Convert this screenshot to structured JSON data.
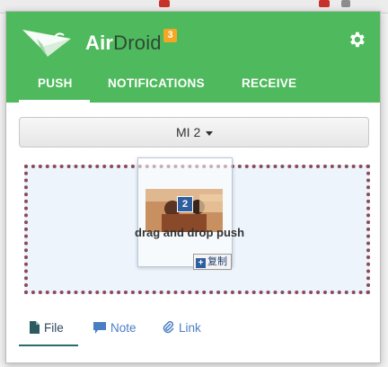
{
  "app": {
    "name_part1": "Air",
    "name_part2": "Droid",
    "badge_count": "3",
    "brand_color": "#4fba5d"
  },
  "header": {
    "tabs": [
      {
        "label": "PUSH",
        "active": true
      },
      {
        "label": "NOTIFICATIONS",
        "active": false
      },
      {
        "label": "RECEIVE",
        "active": false
      }
    ],
    "settings_icon": "gear-icon"
  },
  "device": {
    "selected": "MI 2"
  },
  "dropzone": {
    "drag_text": "drag and drop push",
    "drag_item_count": "2",
    "copy_tooltip": "复制"
  },
  "bottom_tabs": [
    {
      "label": "File",
      "icon": "file-icon",
      "active": true
    },
    {
      "label": "Note",
      "icon": "note-icon",
      "active": false
    },
    {
      "label": "Link",
      "icon": "paperclip-icon",
      "active": false
    }
  ]
}
